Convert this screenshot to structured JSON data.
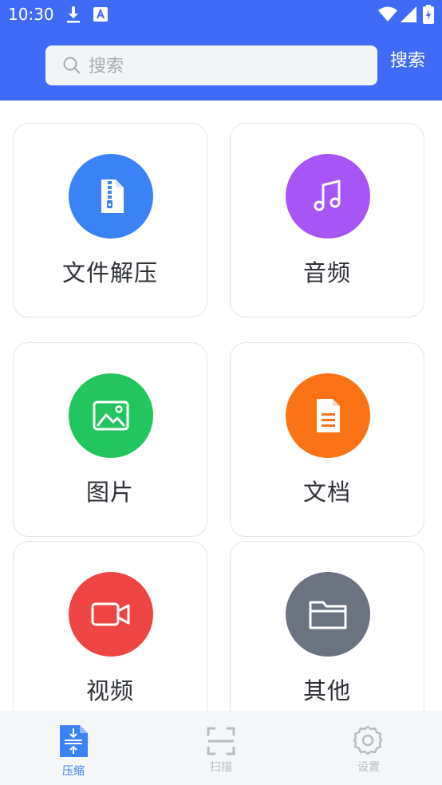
{
  "status_bar": {
    "time": "10:30"
  },
  "search": {
    "placeholder": "搜索",
    "button_label": "搜索"
  },
  "categories": [
    {
      "label": "文件解压",
      "icon": "zip-file-icon",
      "color": "#3b82f6"
    },
    {
      "label": "音频",
      "icon": "music-note-icon",
      "color": "#a855f7"
    },
    {
      "label": "图片",
      "icon": "image-icon",
      "color": "#22c55e"
    },
    {
      "label": "文档",
      "icon": "document-icon",
      "color": "#f97316"
    },
    {
      "label": "视频",
      "icon": "video-camera-icon",
      "color": "#ef4444"
    },
    {
      "label": "其他",
      "icon": "folder-icon",
      "color": "#6b7280"
    }
  ],
  "bottom_nav": [
    {
      "label": "压缩",
      "icon": "compress-icon",
      "active": true
    },
    {
      "label": "扫描",
      "icon": "scan-icon",
      "active": false
    },
    {
      "label": "设置",
      "icon": "settings-gear-icon",
      "active": false
    }
  ],
  "colors": {
    "header": "#3f6bf8",
    "nav_active": "#3b82f6",
    "nav_inactive": "#b8bcc4"
  }
}
